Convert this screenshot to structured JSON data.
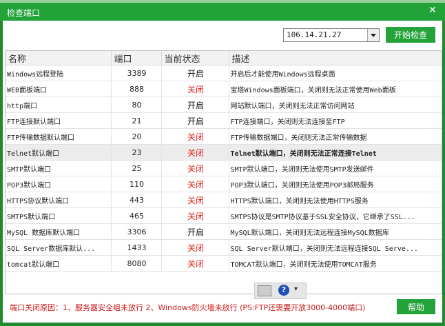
{
  "window": {
    "title": "检查端口",
    "close_glyph": "✕"
  },
  "controls": {
    "ip_value": "106.14.21.27",
    "start_label": "开始检查"
  },
  "table": {
    "headers": [
      "名称",
      "端口",
      "当前状态",
      "描述"
    ],
    "rows": [
      {
        "name": "Windows远程登陆",
        "port": "3389",
        "status": "开启",
        "status_type": "on",
        "desc": "开启后才能使用Windows远程桌面"
      },
      {
        "name": "WEB面板端口",
        "port": "888",
        "status": "关闭",
        "status_type": "off",
        "desc": "宝塔Windows面板端口，关闭则无法正常使用Web面板"
      },
      {
        "name": "http端口",
        "port": "80",
        "status": "开启",
        "status_type": "on",
        "desc": "网站默认端口，关闭则无法正常访问网站"
      },
      {
        "name": "FTP连接默认端口",
        "port": "21",
        "status": "开启",
        "status_type": "on",
        "desc": "FTP连接端口，关闭则无法连接至FTP"
      },
      {
        "name": "FTP传输数据默认端口",
        "port": "20",
        "status": "关闭",
        "status_type": "off",
        "desc": "FTP传输数据端口，关闭则无法正常传输数据"
      },
      {
        "name": "Telnet默认端口",
        "port": "23",
        "status": "关闭",
        "status_type": "off",
        "desc": "Telnet默认端口，关闭则无法正常连接Telnet",
        "highlight": true
      },
      {
        "name": "SMTP默认端口",
        "port": "25",
        "status": "关闭",
        "status_type": "off",
        "desc": "SMTP默认端口，关闭则无法使用SMTP发送邮件"
      },
      {
        "name": "POP3默认端口",
        "port": "110",
        "status": "关闭",
        "status_type": "off",
        "desc": "POP3默认端口，关闭则无法使用POP3邮局服务"
      },
      {
        "name": "HTTPS协议默认端口",
        "port": "443",
        "status": "关闭",
        "status_type": "off",
        "desc": "HTTPS默认端口，关闭则无法使用HTTPS服务"
      },
      {
        "name": "SMTPS默认端口",
        "port": "465",
        "status": "关闭",
        "status_type": "off",
        "desc": "SMTPS协议是SMTP协议基于SSL安全协议，它继承了SSL..."
      },
      {
        "name": "MySQL 数据库默认端口",
        "port": "3306",
        "status": "开启",
        "status_type": "on",
        "desc": "MySQL默认端口，关闭则无法远程连接MySQL数据库"
      },
      {
        "name": "SQL Server数据库默认...",
        "port": "1433",
        "status": "关闭",
        "status_type": "off",
        "desc": "SQL Server默认端口，关闭则无法远程连接SQL Serve..."
      },
      {
        "name": "tomcat默认端口",
        "port": "8080",
        "status": "关闭",
        "status_type": "off",
        "desc": "TOMCAT默认端口，关闭则无法使用TOMCAT服务"
      }
    ]
  },
  "mini_toolbar": {
    "help_glyph": "?",
    "more_glyph": "▾"
  },
  "footer": {
    "note": "端口关闭原因：1、服务器安全组未放行  2、Windows防火墙未放行  (PS:FTP还需要开放3000-4000端口)",
    "help_label": "帮助"
  },
  "colors": {
    "accent": "#25a33b",
    "closed": "#e02020"
  }
}
